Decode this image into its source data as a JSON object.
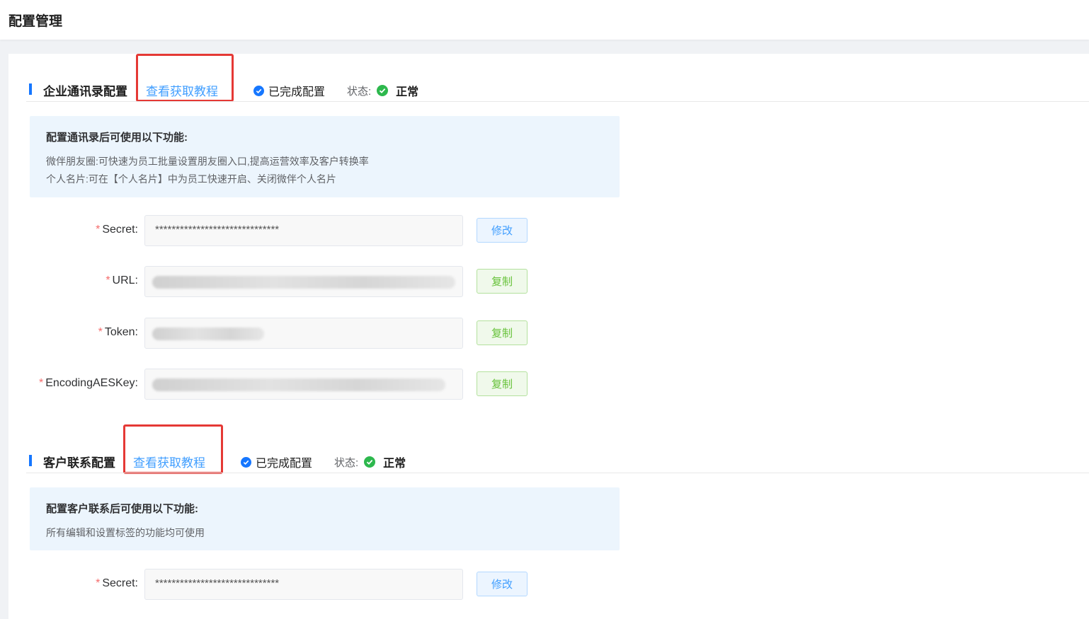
{
  "page": {
    "title": "配置管理"
  },
  "colors": {
    "accent": "#1677ff",
    "link": "#409eff",
    "success": "#2db84d",
    "required": "#f56c6c",
    "highlight_box": "#e53935"
  },
  "icons": {
    "done": "check-circle-icon",
    "status": "success-circle-icon"
  },
  "contacts_section": {
    "title": "企业通讯录配置",
    "tutorial_link": "查看获取教程",
    "done_label": "已完成配置",
    "status_label": "状态:",
    "status_value": "正常",
    "info": {
      "title": "配置通讯录后可使用以下功能:",
      "lines": [
        "微伴朋友圈:可快速为员工批量设置朋友圈入口,提高运营效率及客户转换率",
        "个人名片:可在【个人名片】中为员工快速开启、关闭微伴个人名片"
      ]
    },
    "fields": [
      {
        "label": "Secret:",
        "value": "******************************",
        "masked": false,
        "button": "修改"
      },
      {
        "label": "URL:",
        "value": "",
        "masked": true,
        "button": "复制"
      },
      {
        "label": "Token:",
        "value": "",
        "masked": true,
        "button": "复制"
      },
      {
        "label": "EncodingAESKey:",
        "value": "",
        "masked": true,
        "button": "复制"
      }
    ]
  },
  "customer_section": {
    "title": "客户联系配置",
    "tutorial_link": "查看获取教程",
    "done_label": "已完成配置",
    "status_label": "状态:",
    "status_value": "正常",
    "info": {
      "title": "配置客户联系后可使用以下功能:",
      "lines": [
        "所有编辑和设置标签的功能均可使用"
      ]
    },
    "fields": [
      {
        "label": "Secret:",
        "value": "******************************",
        "masked": false,
        "button": "修改"
      }
    ]
  }
}
